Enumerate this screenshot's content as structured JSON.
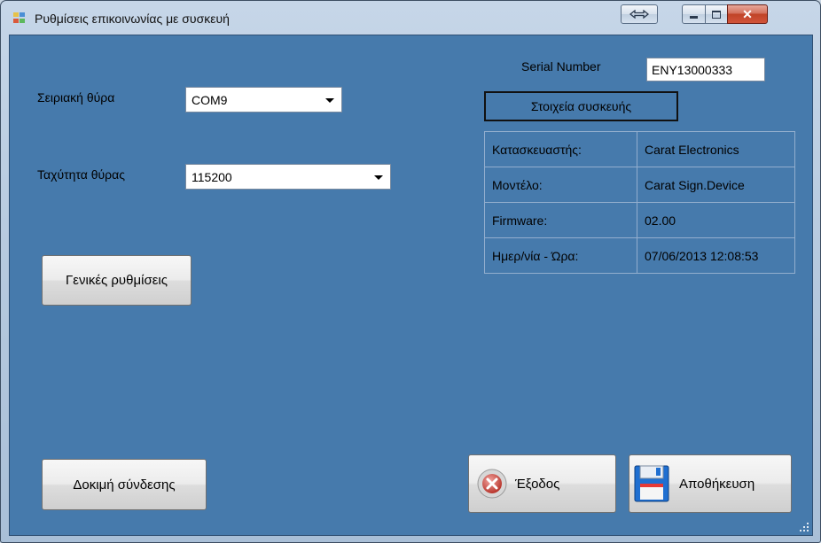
{
  "window": {
    "title": "Ρυθμίσεις επικοινωνίας με συσκευή",
    "controls": [
      "swap-icon",
      "minimize-icon",
      "maximize-icon",
      "close-icon"
    ]
  },
  "left": {
    "port_label": "Σειριακή θύρα",
    "port_value": "COM9",
    "speed_label": "Ταχύτητα θύρας",
    "speed_value": "115200",
    "general_settings_button": "Γενικές ρυθμίσεις",
    "test_connection_button": "Δοκιμή σύνδεσης"
  },
  "right": {
    "serial_label": "Serial Number",
    "serial_value": "ENY13000333",
    "device_info_header": "Στοιχεία συσκευής",
    "rows": [
      {
        "key": "Κατασκευαστής:",
        "value": "Carat Electronics"
      },
      {
        "key": "Μοντέλο:",
        "value": "Carat Sign.Device"
      },
      {
        "key": "Firmware:",
        "value": "02.00"
      },
      {
        "key": "Ημερ/νία - Ώρα:",
        "value": "07/06/2013 12:08:53"
      }
    ]
  },
  "footer": {
    "exit_button": "Έξοδος",
    "save_button": "Αποθήκευση"
  },
  "colors": {
    "client_background": "#467aac",
    "exit_icon": "#c0392b",
    "save_icon": "#1f6fd1"
  }
}
